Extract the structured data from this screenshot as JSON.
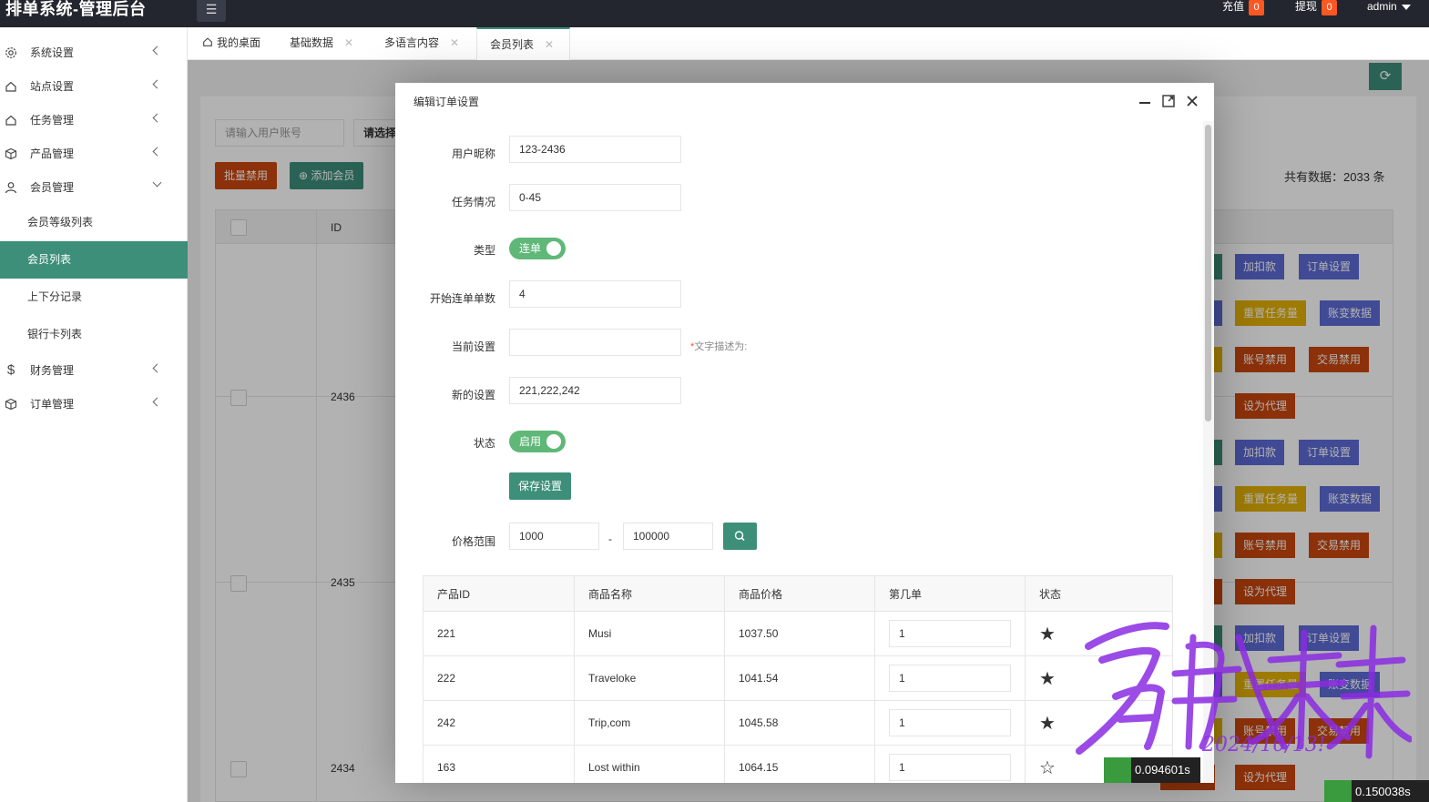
{
  "header": {
    "title": "排单系统-管理后台",
    "recharge_label": "充值",
    "recharge_count": "0",
    "withdraw_label": "提现",
    "withdraw_count": "0",
    "user": "admin"
  },
  "sidebar": {
    "items": [
      {
        "label": "系统设置",
        "icon": "gear-icon"
      },
      {
        "label": "站点设置",
        "icon": "home-icon"
      },
      {
        "label": "任务管理",
        "icon": "home-icon"
      },
      {
        "label": "产品管理",
        "icon": "box-icon"
      },
      {
        "label": "会员管理",
        "icon": "user-icon"
      },
      {
        "label": "财务管理",
        "icon": "dollar-icon"
      },
      {
        "label": "订单管理",
        "icon": "box-icon"
      }
    ],
    "subitems": [
      "会员等级列表",
      "会员列表",
      "上下分记录",
      "银行卡列表"
    ]
  },
  "tabs": [
    {
      "label": "我的桌面"
    },
    {
      "label": "基础数据"
    },
    {
      "label": "多语言内容"
    },
    {
      "label": "会员列表"
    }
  ],
  "toolbar": {
    "account_placeholder": "请输入用户账号",
    "select_placeholder": "请选择",
    "batch_disable": "批量禁用",
    "add_member": "添加会员",
    "total": "共有数据：2033 条"
  },
  "bg_table": {
    "id_header": "ID",
    "ids": [
      "2436",
      "2435",
      "2434"
    ],
    "actions": {
      "add_deduct": "加扣款",
      "order_settings": "订单设置",
      "reset_tasks": "重置任务量",
      "account_changes": "账变数据",
      "disable_account": "账号禁用",
      "disable_trade": "交易禁用",
      "set_agent": "设为代理"
    }
  },
  "modal": {
    "title": "编辑订单设置",
    "fields": {
      "nickname_label": "用户昵称",
      "nickname_value": "123-2436",
      "task_label": "任务情况",
      "task_value": "0-45",
      "type_label": "类型",
      "type_switch": "连单",
      "start_label": "开始连单单数",
      "start_value": "4",
      "current_label": "当前设置",
      "current_value": "",
      "hint": "文字描述为:",
      "new_label": "新的设置",
      "new_value": "221,222,242",
      "status_label": "状态",
      "status_switch": "启用",
      "save_label": "保存设置",
      "price_label": "价格范围",
      "price_min": "1000",
      "price_max": "100000",
      "dash": "-"
    },
    "table": {
      "headers": [
        "产品ID",
        "商品名称",
        "商品价格",
        "第几单",
        "状态"
      ],
      "rows": [
        {
          "id": "221",
          "name": "Musi",
          "price": "1037.50",
          "order": "1",
          "starred": true
        },
        {
          "id": "222",
          "name": "Traveloke",
          "price": "1041.54",
          "order": "1",
          "starred": true
        },
        {
          "id": "242",
          "name": "Trip,com",
          "price": "1045.58",
          "order": "1",
          "starred": true
        },
        {
          "id": "163",
          "name": "Lost within",
          "price": "1064.15",
          "order": "1",
          "starred": false
        }
      ]
    }
  },
  "watermark": {
    "text": "启航未来",
    "date": "2024/10/13!"
  },
  "timers": {
    "modal_timer": "0.094601s",
    "page_timer": "0.150038s"
  },
  "colors": {
    "primary": "#3d8f7a",
    "danger": "#ff5722",
    "warm": "#c9470e",
    "blue": "#5c6bd6",
    "yellow": "#e3b007",
    "switch": "#5fb878"
  }
}
